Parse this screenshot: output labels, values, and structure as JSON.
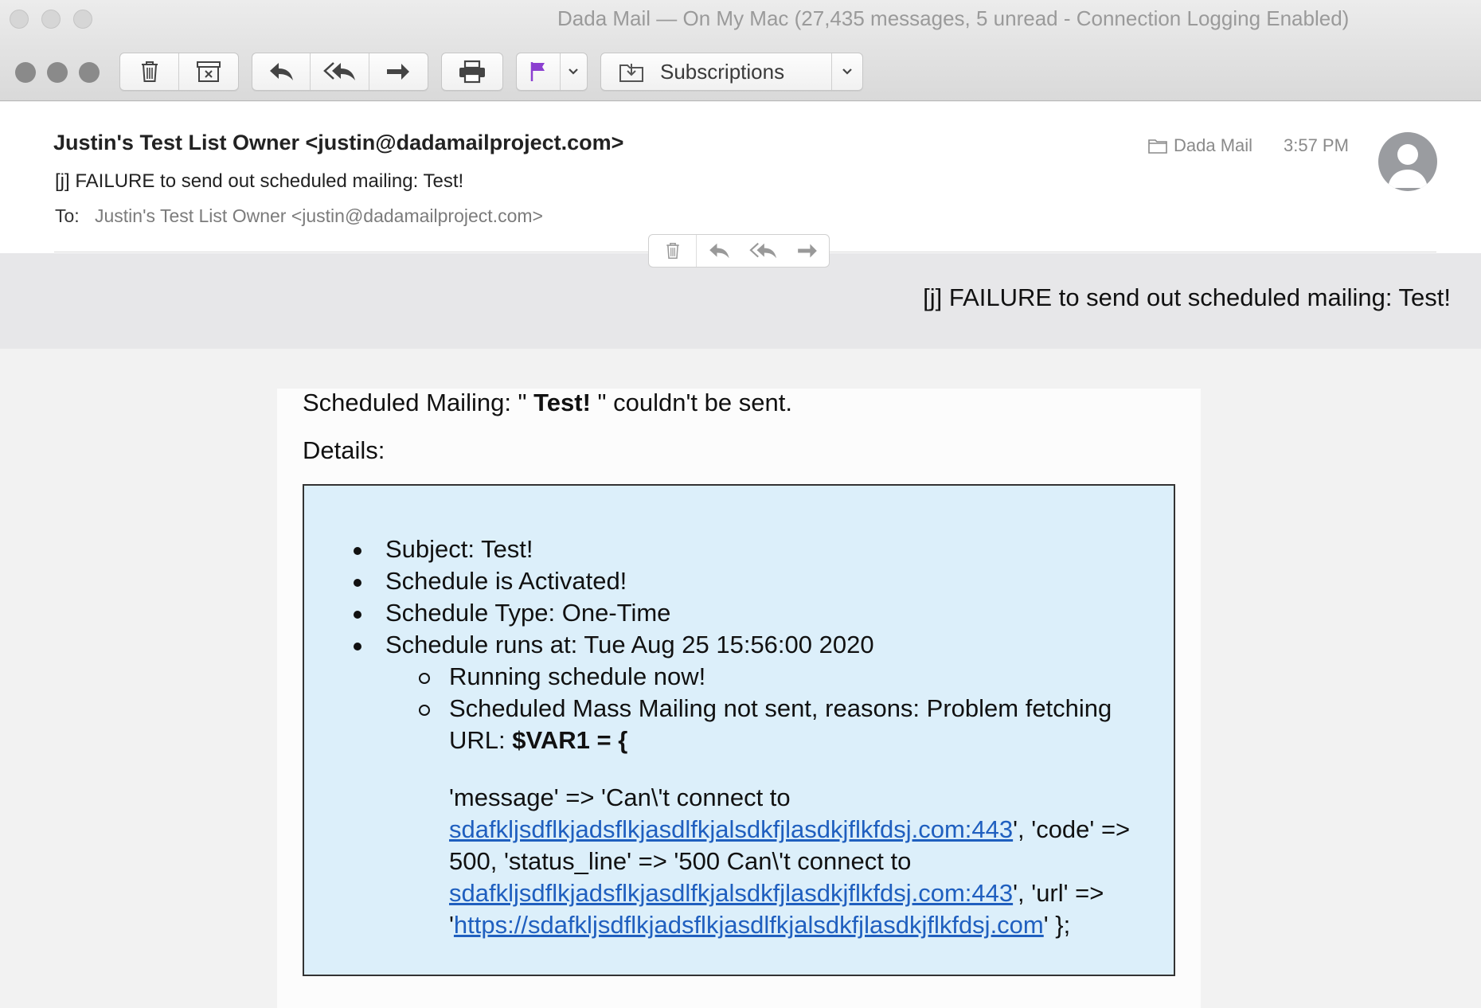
{
  "window": {
    "title": "Dada Mail — On My Mac (27,435 messages, 5 unread - Connection Logging Enabled)"
  },
  "toolbar": {
    "mailbox_button_label": "Subscriptions",
    "icons": [
      "trash-icon",
      "archive-icon",
      "reply-icon",
      "reply-all-icon",
      "forward-icon",
      "print-icon",
      "flag-icon",
      "chevron-down-icon",
      "move-to-mailbox-icon"
    ],
    "flag_color": "#8b3fd0"
  },
  "header": {
    "from": "Justin's Test List Owner <justin@dadamailproject.com>",
    "subject": "[j] FAILURE to send out scheduled mailing: Test!",
    "to_label": "To:",
    "to_value": "Justin's Test List Owner <justin@dadamailproject.com>",
    "mailbox": "Dada Mail",
    "time": "3:57 PM"
  },
  "banner": {
    "subject": "[j] FAILURE to send out scheduled mailing: Test!"
  },
  "body": {
    "line1_prefix": "Scheduled Mailing: \" ",
    "line1_bold": "Test!",
    "line1_suffix": " \" couldn't be sent.",
    "details_label": "Details:",
    "items": [
      "Subject: Test!",
      "Schedule is Activated!",
      "Schedule Type: One-Time",
      "Schedule runs at: Tue Aug 25 15:56:00 2020"
    ],
    "sub_items": {
      "running": "Running schedule now!",
      "not_sent_prefix": "Scheduled Mass Mailing not sent, reasons: Problem fetching URL: ",
      "not_sent_bold": "$VAR1 = {",
      "var_text_1": "'message' => 'Can\\'t connect to ",
      "link_1": "sdafkljsdflkjadsflkjasdlfkjalsdkfjlasdkjflkfdsj.com:443",
      "var_text_2": "', 'code' => 500, 'status_line' => '500 Can\\'t connect to ",
      "link_2": "sdafkljsdflkjadsflkjasdlfkjalsdkfjlasdkjflkfdsj.com:443",
      "var_text_3": "', 'url' => '",
      "link_3": "https://sdafkljsdflkjadsflkjasdlfkjalsdkfjlasdkjflkfdsj.com",
      "var_text_4": "' };"
    }
  },
  "colors": {
    "detail_box_bg": "#dceffa",
    "link": "#1f5fbf",
    "banner_bg": "#e7e7e9"
  }
}
